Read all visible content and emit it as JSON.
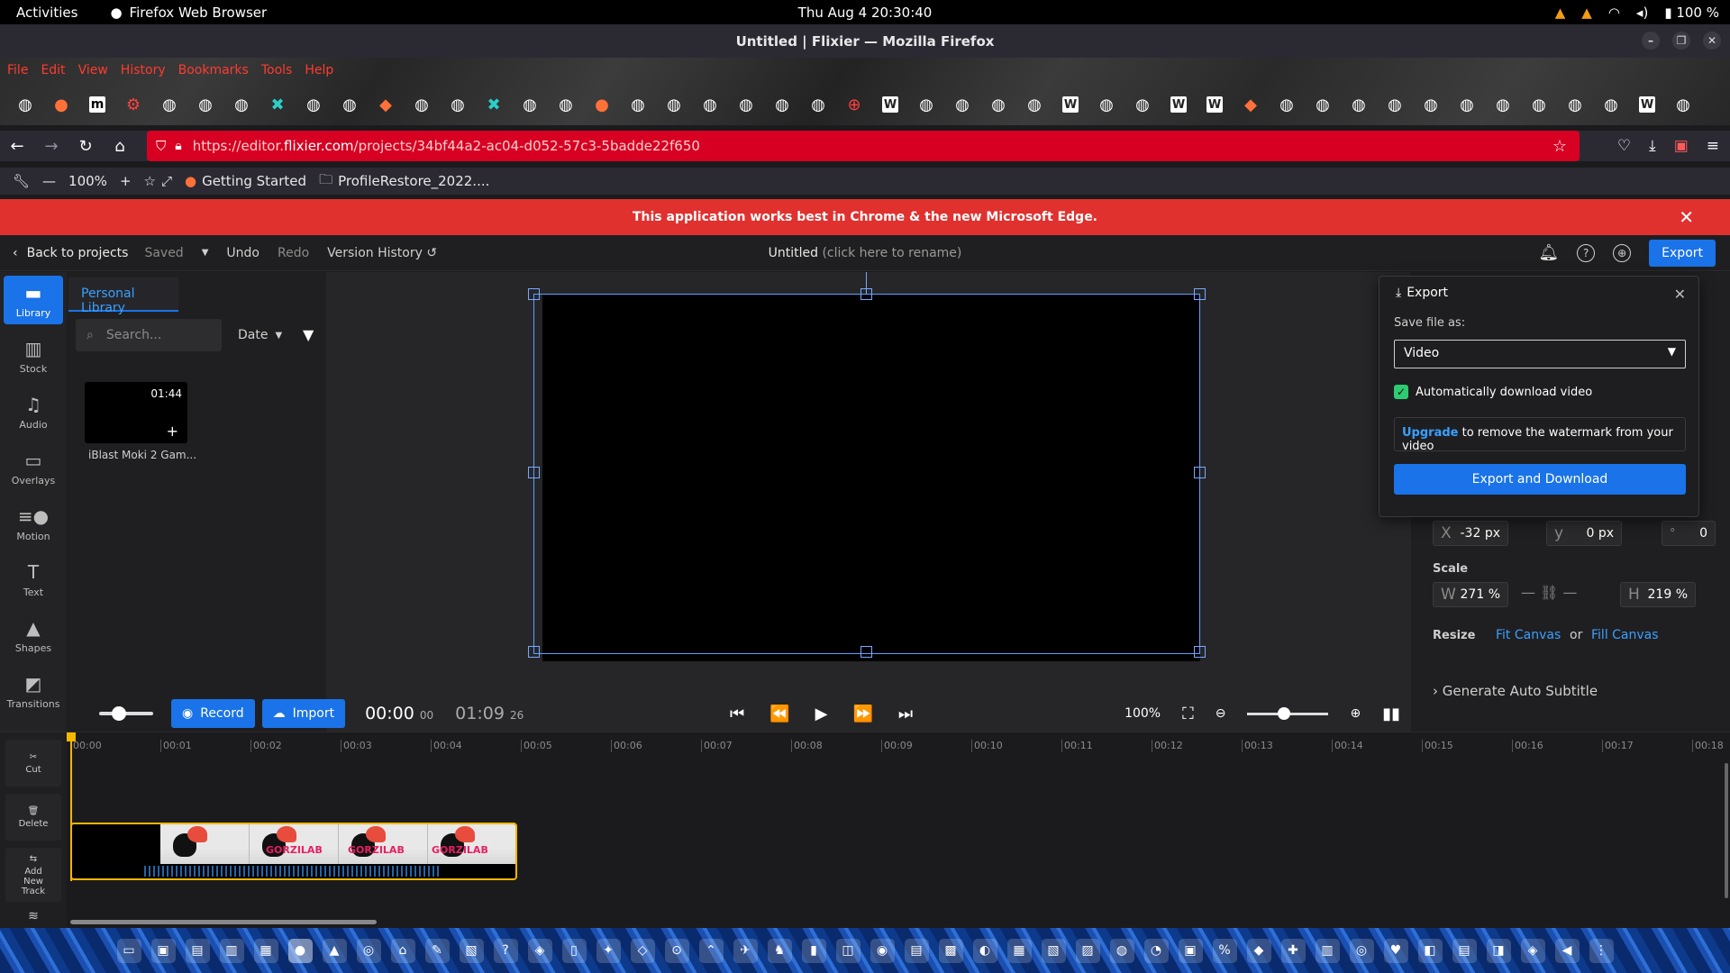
{
  "system_bar": {
    "activities": "Activities",
    "app": "Firefox Web Browser",
    "clock": "Thu Aug 4  20:30:40",
    "battery": "100 %"
  },
  "window": {
    "title": "Untitled | Flixier — Mozilla Firefox"
  },
  "menu": [
    "File",
    "Edit",
    "View",
    "History",
    "Bookmarks",
    "Tools",
    "Help"
  ],
  "tabs": [
    "github",
    "firefox",
    "m",
    "gear",
    "github",
    "github",
    "github",
    "cross",
    "github",
    "github",
    "brave",
    "github",
    "github",
    "cross",
    "github",
    "github",
    "firefox",
    "github",
    "github",
    "github",
    "github",
    "github",
    "github",
    "globe",
    "W",
    "github",
    "github",
    "github",
    "github",
    "W",
    "github",
    "github",
    "W",
    "W",
    "brave",
    "github",
    "github",
    "github",
    "github",
    "github",
    "github",
    "github",
    "github",
    "github",
    "github",
    "W",
    "github"
  ],
  "nav": {
    "url": "https://editor.flixier.com/projects/34bf44a2-ac04-d052-57c3-5badde22f650",
    "url_prefix": "https://editor.",
    "url_domain": "flixier.com",
    "url_path": "/projects/34bf44a2-ac04-d052-57c3-5badde22f650"
  },
  "bookmarks_bar": {
    "zoom": "100%",
    "items": [
      "Getting Started",
      "ProfileRestore_2022...."
    ]
  },
  "banner": {
    "text": "This application works best in Chrome & the new Microsoft Edge."
  },
  "header": {
    "back": "Back to projects",
    "saved": "Saved",
    "undo": "Undo",
    "redo": "Redo",
    "version_history": "Version History",
    "title": "Untitled",
    "title_hint": "(click here to rename)",
    "export": "Export"
  },
  "sidebar": [
    {
      "label": "Library",
      "icon": "folder-icon"
    },
    {
      "label": "Stock",
      "icon": "books-icon"
    },
    {
      "label": "Audio",
      "icon": "music-icon"
    },
    {
      "label": "Overlays",
      "icon": "overlay-icon"
    },
    {
      "label": "Motion",
      "icon": "motion-icon"
    },
    {
      "label": "Text",
      "icon": "text-icon"
    },
    {
      "label": "Shapes",
      "icon": "shapes-icon"
    },
    {
      "label": "Transitions",
      "icon": "transitions-icon"
    }
  ],
  "library": {
    "tab": "Personal Library",
    "search_placeholder": "Search...",
    "sort": "Date",
    "item_duration": "01:44",
    "item_name": "iBlast Moki 2 Gam..."
  },
  "player": {
    "record": "Record",
    "import": "Import",
    "current": "00:00",
    "current_frames": "00",
    "total": "01:09",
    "total_frames": "26",
    "zoom": "100%"
  },
  "export_panel": {
    "title": "Export",
    "save_as_label": "Save file as:",
    "format": "Video",
    "auto_download": "Automatically download video",
    "upgrade_link": "Upgrade",
    "upgrade_text": "to remove the watermark from your video",
    "button": "Export and Download"
  },
  "properties": {
    "x_key": "X",
    "x": "-32 px",
    "y_key": "y",
    "y": "0 px",
    "rot_key": "°",
    "rotation": "0",
    "scale_label": "Scale",
    "w_key": "W",
    "w": "271 %",
    "h_key": "H",
    "h": "219 %",
    "resize_label": "Resize",
    "fit": "Fit Canvas",
    "or": "or",
    "fill": "Fill Canvas",
    "subtitle": "Generate Auto Subtitle"
  },
  "timeline": {
    "tools": [
      {
        "label": "Cut",
        "icon": "scissors-icon"
      },
      {
        "label": "Delete",
        "icon": "trash-icon"
      },
      {
        "label": "Add New Track",
        "icon": "add-track-icon"
      }
    ],
    "ticks": [
      "00:00",
      "00:01",
      "00:02",
      "00:03",
      "00:04",
      "00:05",
      "00:06",
      "00:07",
      "00:08",
      "00:09",
      "00:10",
      "00:11",
      "00:12",
      "00:13",
      "00:14",
      "00:15",
      "00:16",
      "00:17",
      "00:18"
    ],
    "clip_logo": "GORZILAB"
  },
  "colors": {
    "accent": "#1a73e8",
    "banner": "#e0312f",
    "urlbar": "#d70022",
    "playhead": "#f5b700"
  }
}
